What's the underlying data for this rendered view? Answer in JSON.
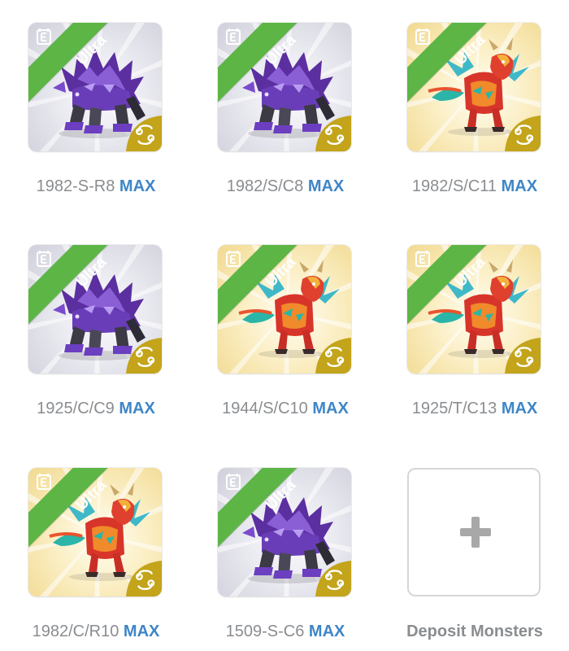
{
  "rarity_label": "Ultra",
  "level_suffix": "MAX",
  "colors": {
    "ribbon": "#5cb545",
    "max_text": "#3e86c7",
    "label_text": "#8a8d90",
    "zodiac_badge": "#c3a41a",
    "gray_card": "#dcdde6",
    "gold_card": "#f8e9b8"
  },
  "monsters": [
    {
      "name": "1982-S-R8",
      "type": "purple-armored-beast",
      "card": "gray",
      "element_icon": "element-e-icon",
      "zodiac_icon": "cancer-zodiac-icon"
    },
    {
      "name": "1982/S/C8",
      "type": "purple-armored-beast",
      "card": "gray",
      "element_icon": "element-e-icon",
      "zodiac_icon": "cancer-zodiac-icon"
    },
    {
      "name": "1982/S/C11",
      "type": "red-dragon",
      "card": "gold",
      "element_icon": "element-e-icon",
      "zodiac_icon": "cancer-zodiac-icon"
    },
    {
      "name": "1925/C/C9",
      "type": "purple-armored-beast",
      "card": "gray",
      "element_icon": "element-e-icon",
      "zodiac_icon": "cancer-zodiac-icon"
    },
    {
      "name": "1944/S/C10",
      "type": "red-dragon",
      "card": "gold",
      "element_icon": "element-e-icon",
      "zodiac_icon": "cancer-zodiac-icon"
    },
    {
      "name": "1925/T/C13",
      "type": "red-dragon",
      "card": "gold",
      "element_icon": "element-e-icon",
      "zodiac_icon": "cancer-zodiac-icon"
    },
    {
      "name": "1982/C/R10",
      "type": "red-dragon",
      "card": "gold",
      "element_icon": "element-e-icon",
      "zodiac_icon": "cancer-zodiac-icon"
    },
    {
      "name": "1509-S-C6",
      "type": "purple-armored-beast",
      "card": "gray",
      "element_icon": "element-e-icon",
      "zodiac_icon": "cancer-zodiac-icon"
    }
  ],
  "deposit": {
    "label": "Deposit Monsters",
    "icon": "plus-icon"
  }
}
